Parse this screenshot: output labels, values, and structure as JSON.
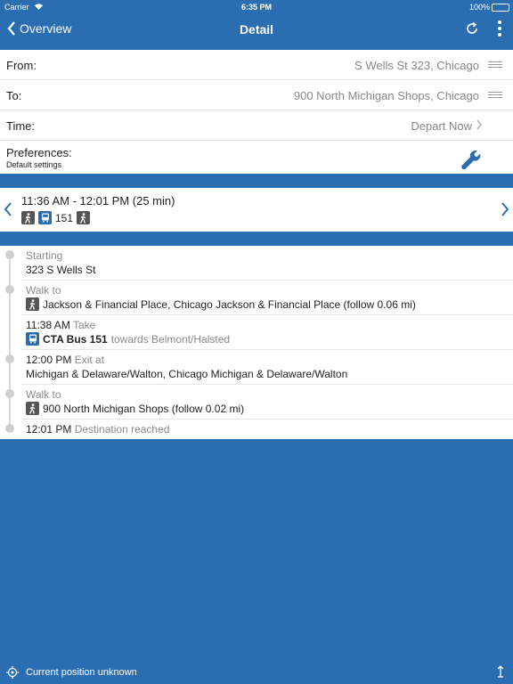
{
  "status_bar": {
    "carrier": "Carrier",
    "time": "6:35 PM",
    "battery": "100%"
  },
  "nav": {
    "back_label": "Overview",
    "title": "Detail"
  },
  "form": {
    "from": {
      "label": "From:",
      "value": "S Wells St 323, Chicago"
    },
    "to": {
      "label": "To:",
      "value": "900 North Michigan Shops, Chicago"
    },
    "time": {
      "label": "Time:",
      "value": "Depart Now"
    },
    "preferences": {
      "label": "Preferences:",
      "sub": "Default settings"
    }
  },
  "summary": {
    "timespan": "11:36 AM - 12:01 PM (25 min)",
    "bus_number": "151"
  },
  "steps": [
    {
      "title": "Starting",
      "detail": "323 S Wells St"
    },
    {
      "title": "Walk to",
      "detail": "Jackson & Financial Place, Chicago Jackson & Financial Place (follow 0.06 mi)"
    },
    {
      "time": "11:38 AM",
      "action": "Take",
      "route": "CTA Bus 151",
      "towards": "towards Belmont/Halsted"
    },
    {
      "time": "12:00 PM",
      "action": "Exit at",
      "detail": "Michigan & Delaware/Walton, Chicago Michigan & Delaware/Walton"
    },
    {
      "title": "Walk to",
      "detail": "900 North Michigan Shops (follow 0.02 mi)"
    },
    {
      "time": "12:01 PM",
      "action": "Destination reached"
    }
  ],
  "footer": {
    "text": "Current position unknown"
  },
  "colors": {
    "brand": "#2a6db0",
    "walk_chip": "#555555"
  }
}
